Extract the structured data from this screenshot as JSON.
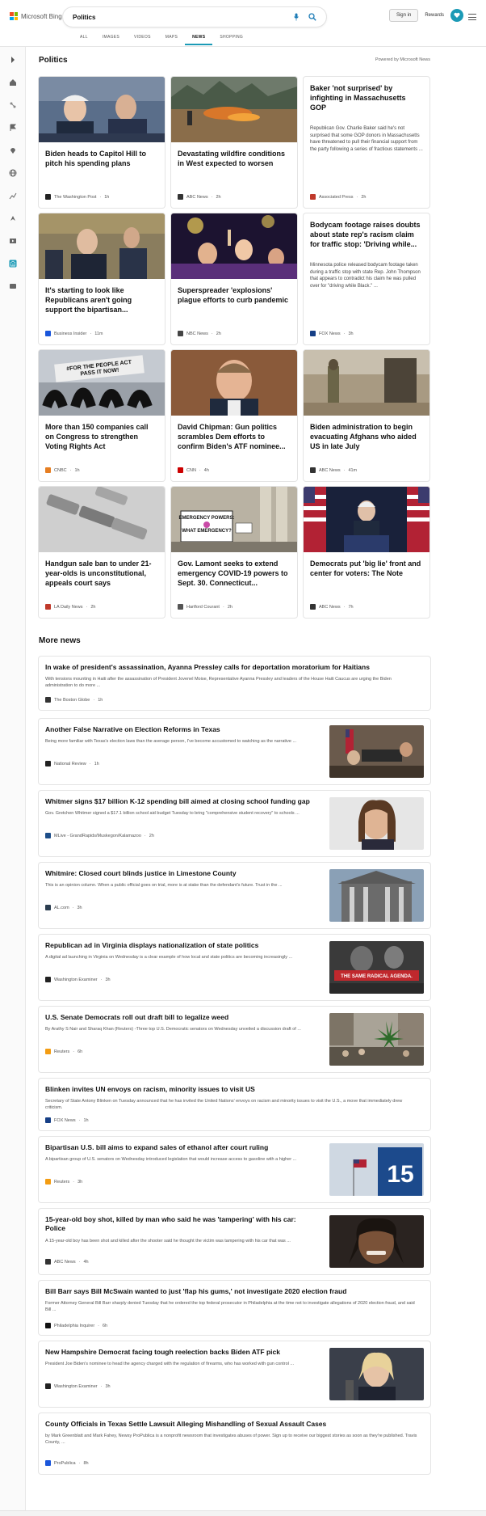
{
  "brand": {
    "name": "Microsoft Bing"
  },
  "search": {
    "query": "Politics"
  },
  "header": {
    "signin": "Sign in",
    "rewards": "Rewards"
  },
  "tabs": [
    "ALL",
    "IMAGES",
    "VIDEOS",
    "MAPS",
    "NEWS",
    "SHOPPING"
  ],
  "active_tab": "NEWS",
  "section": {
    "title": "Politics",
    "powered": "Powered by Microsoft News"
  },
  "cards": [
    {
      "title": "Biden heads to Capitol Hill to pitch his spending plans",
      "source": "The Washington Post",
      "time": "1h",
      "src_color": "#222"
    },
    {
      "title": "Devastating wildfire conditions in West expected to worsen",
      "source": "ABC News",
      "time": "2h",
      "src_color": "#333"
    },
    {
      "title": "Baker 'not surprised' by infighting in Massachusetts GOP",
      "snippet": "Republican Gov. Charlie Baker said he's not surprised that some GOP donors in Massachusetts have threatened to pull their financial support from the party following a series of fractious statements ...",
      "source": "Associated Press",
      "time": "2h",
      "src_color": "#c0392b"
    },
    {
      "title": "It's starting to look like Republicans aren't going support the bipartisan...",
      "source": "Business Insider",
      "time": "11m",
      "src_color": "#1a56db"
    },
    {
      "title": "Superspreader 'explosions' plague efforts to curb pandemic",
      "source": "NBC News",
      "time": "2h",
      "src_color": "#444"
    },
    {
      "title": "Bodycam footage raises doubts about state rep's racism claim for traffic stop: 'Driving while...",
      "snippet": "Minnesota police released bodycam footage taken during a traffic stop with state Rep. John Thompson that appears to contradict his claim he was pulled over for \"driving while Black.\" ...",
      "source": "FOX News",
      "time": "3h",
      "src_color": "#163f86"
    },
    {
      "title": "More than 150 companies call on Congress to strengthen Voting Rights Act",
      "source": "CNBC",
      "time": "1h",
      "src_color": "#e67e22"
    },
    {
      "title": "David Chipman: Gun politics scrambles Dem efforts to confirm Biden's ATF nominee...",
      "source": "CNN",
      "time": "4h",
      "src_color": "#cc0000"
    },
    {
      "title": "Biden administration to begin evacuating Afghans who aided US in late July",
      "source": "ABC News",
      "time": "41m",
      "src_color": "#333"
    },
    {
      "title": "Handgun sale ban to under 21-year-olds is unconstitutional, appeals court says",
      "source": "LA Daily News",
      "time": "2h",
      "src_color": "#c0392b"
    },
    {
      "title": "Gov. Lamont seeks to extend emergency COVID-19 powers to Sept. 30. Connecticut...",
      "source": "Hartford Courant",
      "time": "2h",
      "src_color": "#555"
    },
    {
      "title": "Democrats put 'big lie' front and center for voters: The Note",
      "source": "ABC News",
      "time": "7h",
      "src_color": "#333"
    }
  ],
  "card_art": {
    "capitol_sign": "#FOR THE PEOPLE ACT\nPASS IT NOW!",
    "covid_sign": "EMERGENCY POWERS:\nWHAT EMERGENCY?"
  },
  "more_news": {
    "title": "More news",
    "items": [
      {
        "title": "In wake of president's assassination, Ayanna Pressley calls for deportation moratorium for Haitians",
        "snippet": "With tensions mounting in Haiti after the assassination of President Jovenel Moise, Representative Ayanna Pressley and leaders of the House Haiti Caucus are urging the Biden administration to do more ...",
        "source": "The Boston Globe",
        "time": "1h",
        "src_color": "#333"
      },
      {
        "title": "Another False Narrative on Election Reforms in Texas",
        "snippet": "Being more familiar with Texas's election laws than the average person, I've become accustomed to watching as the narrative ...",
        "source": "National Review",
        "time": "1h",
        "src_color": "#222"
      },
      {
        "title": "Whitmer signs $17 billion K-12 spending bill aimed at closing school funding gap",
        "snippet": "Gov. Gretchen Whitmer signed a $17.1 billion school aid budget Tuesday to bring \"comprehensive student recovery\" to schools ...",
        "source": "MLive - GrandRapids/Muskegon/Kalamazoo",
        "time": "2h",
        "src_color": "#1d4e89"
      },
      {
        "title": "Whitmire: Closed court blinds justice in Limestone County",
        "snippet": "This is an opinion column. When a public official goes on trial, more is at stake than the defendant's future. Trust in the ...",
        "source": "AL.com",
        "time": "3h",
        "src_color": "#2c3e50"
      },
      {
        "title": "Republican ad in Virginia displays nationalization of state politics",
        "snippet": "A digital ad launching in Virginia on Wednesday is a clear example of how local and state politics are becoming increasingly ...",
        "source": "Washington Examiner",
        "time": "3h",
        "src_color": "#222"
      },
      {
        "title": "U.S. Senate Democrats roll out draft bill to legalize weed",
        "snippet": "By Arathy S Nair and Sharaq Khan (Reuters) -Three top U.S. Democratic senators on Wednesday unveiled a discussion draft of ...",
        "source": "Reuters",
        "time": "6h",
        "src_color": "#f39c12"
      },
      {
        "title": "Blinken invites UN envoys on racism, minority issues to visit US",
        "snippet": "Secretary of State Antony Blinken on Tuesday announced that he has invited the United Nations' envoys on racism and minority issues to visit the U.S., a move that immediately drew criticism.",
        "source": "FOX News",
        "time": "1h",
        "src_color": "#163f86"
      },
      {
        "title": "Bipartisan U.S. bill aims to expand sales of ethanol after court ruling",
        "snippet": "A bipartisan group of U.S. senators on Wednesday introduced legislation that would increase access to gasoline with a higher ...",
        "source": "Reuters",
        "time": "3h",
        "src_color": "#f39c12"
      },
      {
        "title": "15-year-old boy shot, killed by man who said he was 'tampering' with his car: Police",
        "snippet": "A 15-year-old boy has been shot and killed after the shooter said he thought the victim was tampering with his car that was ...",
        "source": "ABC News",
        "time": "4h",
        "src_color": "#333"
      },
      {
        "title": "Bill Barr says Bill McSwain wanted to just 'flap his gums,' not investigate 2020 election fraud",
        "snippet": "Former Attorney General Bill Barr sharply denied Tuesday that he ordered the top federal prosecutor in Philadelphia at the time not to investigate allegations of 2020 election fraud, and said Bill ...",
        "source": "Philadelphia Inquirer",
        "time": "6h",
        "src_color": "#111"
      },
      {
        "title": "New Hampshire Democrat facing tough reelection backs Biden ATF pick",
        "snippet": "President Joe Biden's nominee to head the agency charged with the regulation of firearms, who has worked with gun control ...",
        "source": "Washington Examiner",
        "time": "3h",
        "src_color": "#222"
      },
      {
        "title": "County Officials in Texas Settle Lawsuit Alleging Mishandling of Sexual Assault Cases",
        "snippet": "by Mark Greenblatt and Mark Fahey, Newsy ProPublica is a nonprofit newsroom that investigates abuses of power. Sign up to receive our biggest stories as soon as they're published. Travis County, ...",
        "source": "ProPublica",
        "time": "8h",
        "src_color": "#1a56db"
      }
    ],
    "thumb_art": {
      "ad_banner": "THE SAME RADICAL AGENDA."
    }
  },
  "footer": {
    "text": ""
  }
}
